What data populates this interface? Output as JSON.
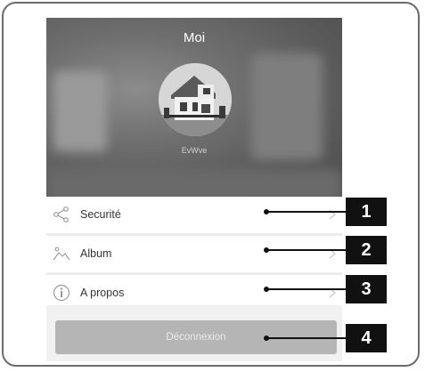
{
  "header": {
    "title": "Moi",
    "username": "EvWve"
  },
  "menu": {
    "items": [
      {
        "label": "Securité",
        "icon": "share-icon"
      },
      {
        "label": "Album",
        "icon": "image-icon"
      },
      {
        "label": "A propos",
        "icon": "info-icon"
      }
    ]
  },
  "logout": {
    "label": "Déconnexion"
  },
  "callouts": [
    "1",
    "2",
    "3",
    "4"
  ]
}
